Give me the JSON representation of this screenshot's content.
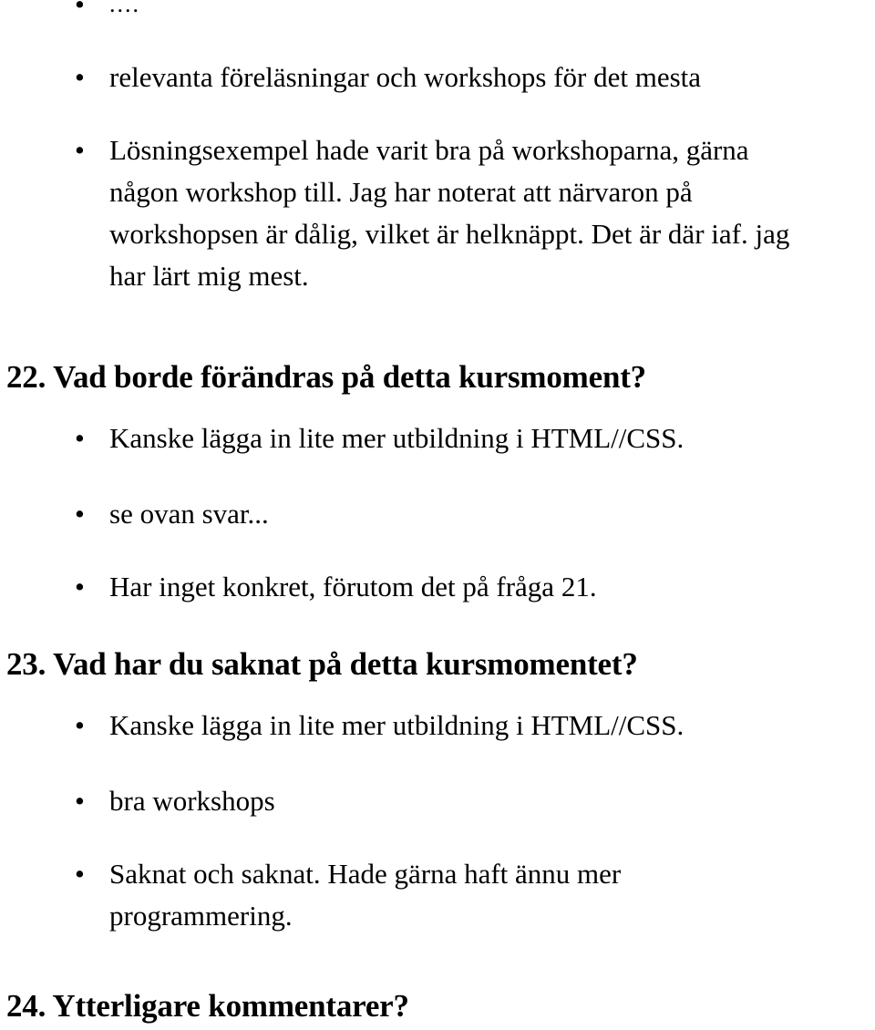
{
  "document": {
    "type": "scanned-survey-results",
    "language": "sv",
    "page_background": "#ffffff",
    "text_color": "#000000"
  },
  "content": {
    "top_fragment_bullet": {
      "marker": "•",
      "text": "...."
    },
    "open_bullets_continued": [
      {
        "marker": "•",
        "lines": [
          "relevanta föreläsningar och workshops för det mesta"
        ]
      },
      {
        "marker": "•",
        "lines": [
          "Lösningsexempel hade varit bra på workshoparna, gärna",
          "någon workshop till. Jag har noterat att närvaron på",
          "workshopsen är dålig, vilket är helknäppt. Det är där iaf. jag",
          "har lärt mig mest."
        ]
      }
    ],
    "questions": [
      {
        "number": "22.",
        "title": "Vad borde förändras på detta kursmoment?",
        "answers": [
          {
            "marker": "•",
            "lines": [
              "Kanske lägga in lite mer utbildning i HTML//CSS."
            ]
          },
          {
            "marker": "•",
            "lines": [
              "se ovan svar..."
            ]
          },
          {
            "marker": "•",
            "lines": [
              "Har inget konkret, förutom det på fråga 21."
            ]
          }
        ]
      },
      {
        "number": "23.",
        "title": "Vad har du saknat på detta kursmomentet?",
        "answers": [
          {
            "marker": "•",
            "lines": [
              "Kanske lägga in lite mer utbildning i HTML//CSS."
            ]
          },
          {
            "marker": "•",
            "lines": [
              "bra workshops"
            ]
          },
          {
            "marker": "•",
            "lines": [
              "Saknat och saknat. Hade gärna haft ännu mer",
              "programmering."
            ]
          }
        ]
      },
      {
        "number": "24.",
        "title": "Ytterligare kommentarer?",
        "answers": []
      }
    ]
  }
}
